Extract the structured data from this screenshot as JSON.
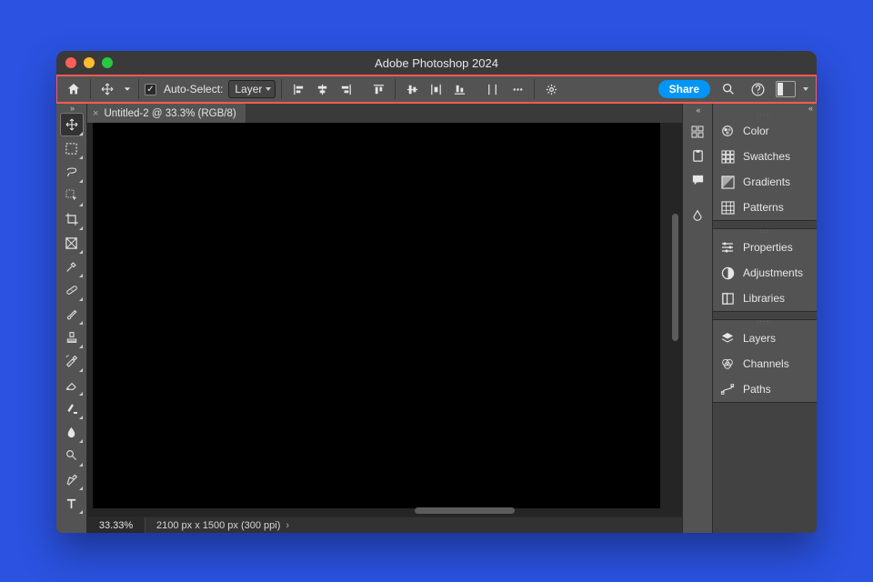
{
  "window_title": "Adobe Photoshop 2024",
  "options_bar": {
    "auto_select_label": "Auto-Select:",
    "auto_select_checked": true,
    "auto_select_mode": "Layer",
    "share_label": "Share"
  },
  "document": {
    "tab_label": "Untitled-2 @ 33.3% (RGB/8)",
    "zoom": "33.33%",
    "status_info": "2100 px x 1500 px (300 ppi)"
  },
  "tools": [
    {
      "name": "move-tool",
      "selected": true
    },
    {
      "name": "marquee-tool",
      "selected": false
    },
    {
      "name": "lasso-tool",
      "selected": false
    },
    {
      "name": "object-selection-tool",
      "selected": false
    },
    {
      "name": "crop-tool",
      "selected": false
    },
    {
      "name": "frame-tool",
      "selected": false
    },
    {
      "name": "eyedropper-tool",
      "selected": false
    },
    {
      "name": "spot-healing-brush-tool",
      "selected": false
    },
    {
      "name": "brush-tool",
      "selected": false
    },
    {
      "name": "clone-stamp-tool",
      "selected": false
    },
    {
      "name": "history-brush-tool",
      "selected": false
    },
    {
      "name": "eraser-tool",
      "selected": false
    },
    {
      "name": "gradient-tool",
      "selected": false
    },
    {
      "name": "blur-tool",
      "selected": false
    },
    {
      "name": "dodge-tool",
      "selected": false
    },
    {
      "name": "pen-tool",
      "selected": false
    },
    {
      "name": "type-tool",
      "selected": false
    }
  ],
  "panels_group1": [
    {
      "name": "color-panel",
      "label": "Color"
    },
    {
      "name": "swatches-panel",
      "label": "Swatches"
    },
    {
      "name": "gradients-panel",
      "label": "Gradients"
    },
    {
      "name": "patterns-panel",
      "label": "Patterns"
    }
  ],
  "panels_group2": [
    {
      "name": "properties-panel",
      "label": "Properties"
    },
    {
      "name": "adjustments-panel",
      "label": "Adjustments"
    },
    {
      "name": "libraries-panel",
      "label": "Libraries"
    }
  ],
  "panels_group3": [
    {
      "name": "layers-panel",
      "label": "Layers"
    },
    {
      "name": "channels-panel",
      "label": "Channels"
    },
    {
      "name": "paths-panel",
      "label": "Paths"
    }
  ],
  "highlight": {
    "target": "options-bar",
    "color": "#ff5a52"
  }
}
